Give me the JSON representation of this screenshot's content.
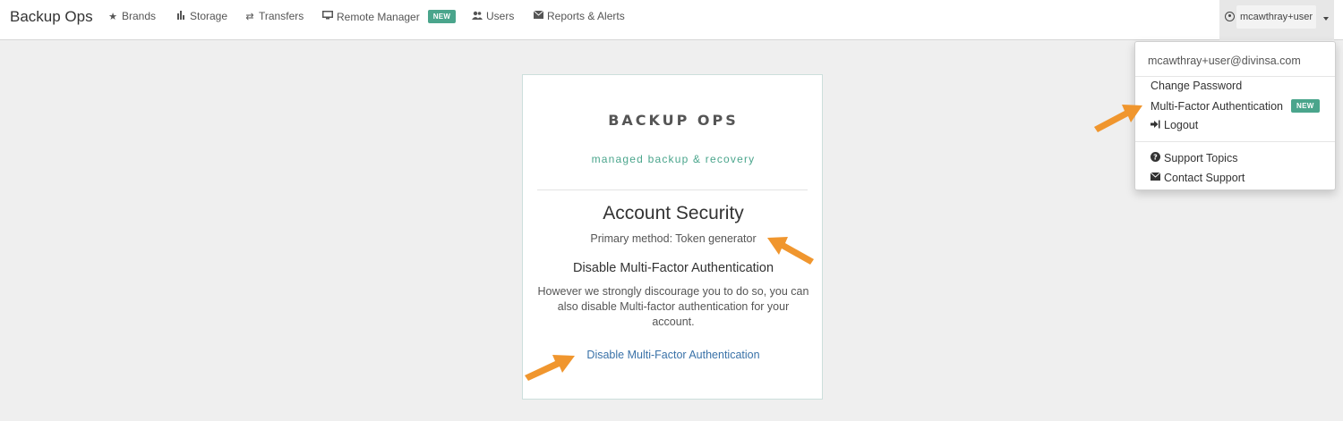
{
  "navbar": {
    "brand": "Backup Ops",
    "items": [
      {
        "label": "Brands",
        "icon": "star-icon"
      },
      {
        "label": "Storage",
        "icon": "bar-chart-icon"
      },
      {
        "label": "Transfers",
        "icon": "transfer-arrows-icon"
      },
      {
        "label": "Remote Manager",
        "icon": "monitor-icon",
        "badge": "NEW"
      },
      {
        "label": "Users",
        "icon": "users-icon"
      },
      {
        "label": "Reports & Alerts",
        "icon": "envelope-icon"
      }
    ],
    "user": "mcawthray+user"
  },
  "dropdown": {
    "email": "mcawthray+user@divinsa.com",
    "items": [
      {
        "label": "Change Password"
      },
      {
        "label": "Multi-Factor Authentication",
        "badge": "NEW"
      },
      {
        "label": "Logout",
        "icon": "logout-icon"
      },
      {
        "label": "Support Topics",
        "icon": "question-circle-icon"
      },
      {
        "label": "Contact Support",
        "icon": "envelope-icon"
      }
    ]
  },
  "card": {
    "logo": "BACKUP OPS",
    "tagline": "managed backup & recovery",
    "title": "Account Security",
    "primary_method": "Primary method: Token generator",
    "heading": "Disable Multi-Factor Authentication",
    "body": "However we strongly discourage you to do so, you can also disable Multi-factor authentication for your account.",
    "link": "Disable Multi-Factor Authentication"
  },
  "colors": {
    "accent": "#4aa58c",
    "link": "#3a72a8",
    "annotation_arrow": "#f0962e"
  }
}
